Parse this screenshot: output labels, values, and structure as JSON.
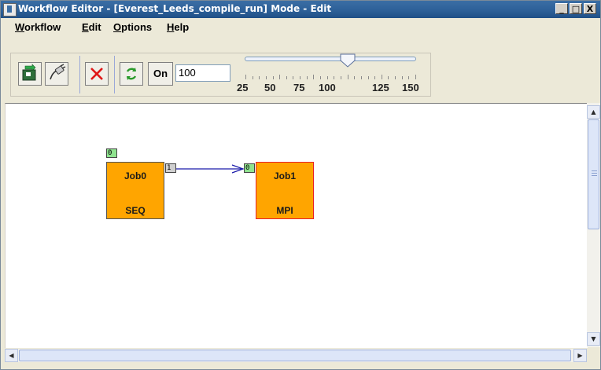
{
  "window": {
    "title": "Workflow Editor - [Everest_Leeds_compile_run] Mode - Edit",
    "controls": {
      "minimize": "_",
      "maximize": "□",
      "close": "X"
    }
  },
  "menu": [
    {
      "mnemonic": "W",
      "rest": "orkflow"
    },
    {
      "mnemonic": "E",
      "rest": "dit"
    },
    {
      "mnemonic": "O",
      "rest": "ptions"
    },
    {
      "mnemonic": "H",
      "rest": "elp"
    }
  ],
  "toolbar": {
    "buttons": [
      {
        "icon": "add-job-icon"
      },
      {
        "icon": "connect-plug-icon"
      },
      {
        "icon": "delete-x-icon"
      },
      {
        "icon": "refresh-icon"
      }
    ],
    "toggle_label": "On",
    "zoom_value": "100",
    "zoom_slider": {
      "min": 25,
      "max": 150,
      "value": 100,
      "labels": [
        "25",
        "50",
        "75",
        "100",
        "125",
        "150"
      ]
    }
  },
  "canvas": {
    "jobs": [
      {
        "name": "Job0",
        "type": "SEQ",
        "input_port": "0",
        "output_port": "1"
      },
      {
        "name": "Job1",
        "type": "MPI",
        "input_port": "0"
      }
    ],
    "connection": {
      "from": "Job0",
      "to": "Job1",
      "color": "#1a1aaa"
    }
  },
  "colors": {
    "job_fill": "#ffa500",
    "input_port": "#8fe38f",
    "output_port": "#cfcfcf",
    "selected_border": "#e8202a",
    "title_bar": "#2c5f97"
  }
}
